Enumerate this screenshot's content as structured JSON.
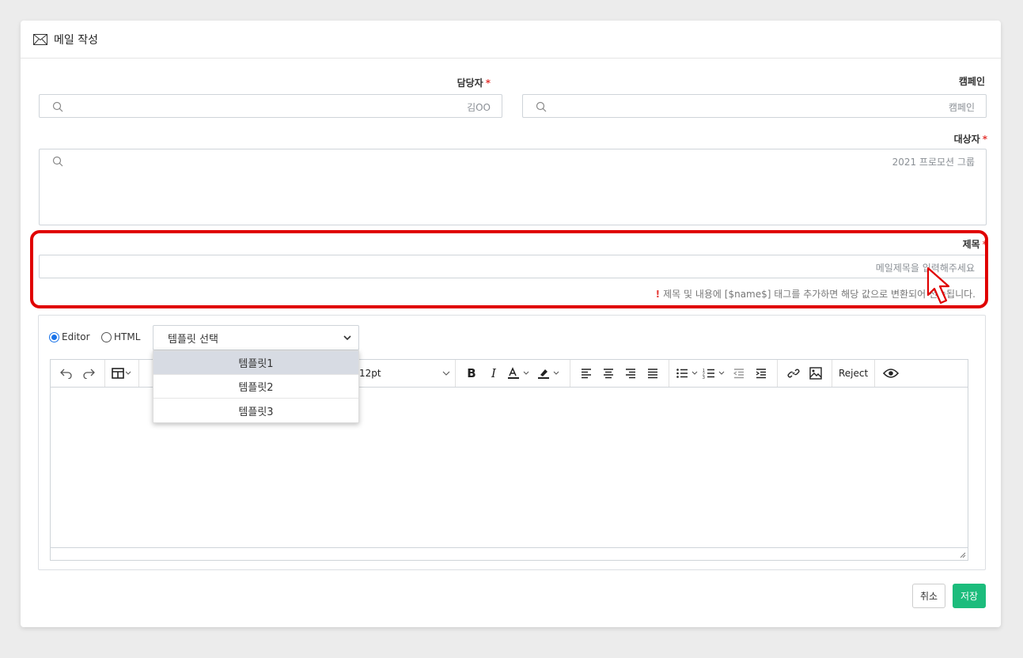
{
  "header": {
    "title": "메일 작성",
    "icon": "mail-icon"
  },
  "fields": {
    "manager": {
      "label": "담당자",
      "required": true,
      "value": "김OO"
    },
    "campaign": {
      "label": "캠페인",
      "required": false,
      "value": "캠페인"
    },
    "target": {
      "label": "대상자",
      "required": true,
      "value": "2021 프로모션 그룹"
    },
    "subject": {
      "label": "제목",
      "required": true,
      "placeholder": "메일제목을 입력해주세요"
    },
    "required_mark": "*"
  },
  "notice": {
    "bang": "!",
    "text": "제목 및 내용에 [$name$] 태그를 추가하면 해당 값으로 변환되어 전송됩니다."
  },
  "editor": {
    "modes": [
      {
        "label": "Editor",
        "selected": true
      },
      {
        "label": "HTML",
        "selected": false
      }
    ],
    "template_select": {
      "label": "템플릿 선택",
      "options": [
        "템플릿1",
        "템플릿2",
        "템플릿3"
      ],
      "highlighted": "템플릿1"
    },
    "toolbar": {
      "font_size": "12pt",
      "reject_label": "Reject"
    }
  },
  "buttons": {
    "cancel": "취소",
    "save": "저장"
  },
  "colors": {
    "accent_blue": "#1a73e8",
    "save_green": "#1cbc7c",
    "required_red": "#e53935",
    "highlight_red": "#e00000"
  }
}
